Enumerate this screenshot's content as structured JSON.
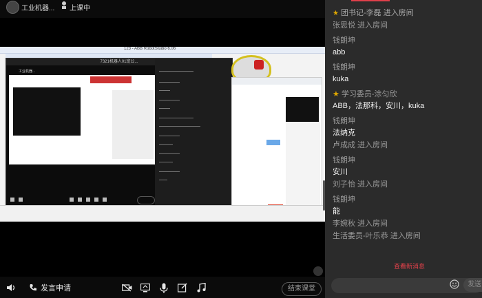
{
  "top_bar": {
    "user_name": "工业机器...",
    "status": "上课中"
  },
  "shared_screen": {
    "window_title": "7321机器人01班公...",
    "app_title": "123 - ABB RobotStudio 6.06"
  },
  "toolbar": {
    "apply_speak": "发言申请",
    "end_class": "结束课堂"
  },
  "chat": {
    "messages": [
      {
        "type": "system",
        "role_badge": true,
        "text": "团书记-李磊 进入房间"
      },
      {
        "type": "system",
        "role_badge": false,
        "text": "张思悦 进入房间"
      },
      {
        "type": "chat",
        "sender": "钱朗坤",
        "text": "abb"
      },
      {
        "type": "chat",
        "sender": "钱朗坤",
        "text": "kuka"
      },
      {
        "type": "chat",
        "sender": "学习委员-涂匀欣",
        "role_badge": true,
        "text": "ABB，法那科，安川，kuka"
      },
      {
        "type": "chat",
        "sender": "钱朗坤",
        "text": "法纳克"
      },
      {
        "type": "system",
        "role_badge": false,
        "text": "卢成成 进入房间"
      },
      {
        "type": "chat",
        "sender": "钱朗坤",
        "text": "安川"
      },
      {
        "type": "system",
        "role_badge": false,
        "text": "刘子怡 进入房间"
      },
      {
        "type": "chat",
        "sender": "钱朗坤",
        "text": "能"
      },
      {
        "type": "system",
        "role_badge": false,
        "text": "李婉秋 进入房间"
      },
      {
        "type": "system",
        "role_badge": false,
        "text": "生活委员-叶乐恭 进入房间"
      }
    ],
    "new_messages_hint": "查看新消息",
    "send_label": "发送"
  },
  "icons": [
    "avatar",
    "status-icon",
    "speaker-icon",
    "phone-icon",
    "video-icon",
    "screen-share-icon",
    "mic-icon",
    "edit-icon",
    "music-icon",
    "emoji-icon",
    "star-badge-icon"
  ],
  "colors": {
    "accent": "#e0404a",
    "badge": "#e0a800",
    "chat_bg": "#2b2b2b",
    "bar_bg": "#0b0b0b"
  }
}
